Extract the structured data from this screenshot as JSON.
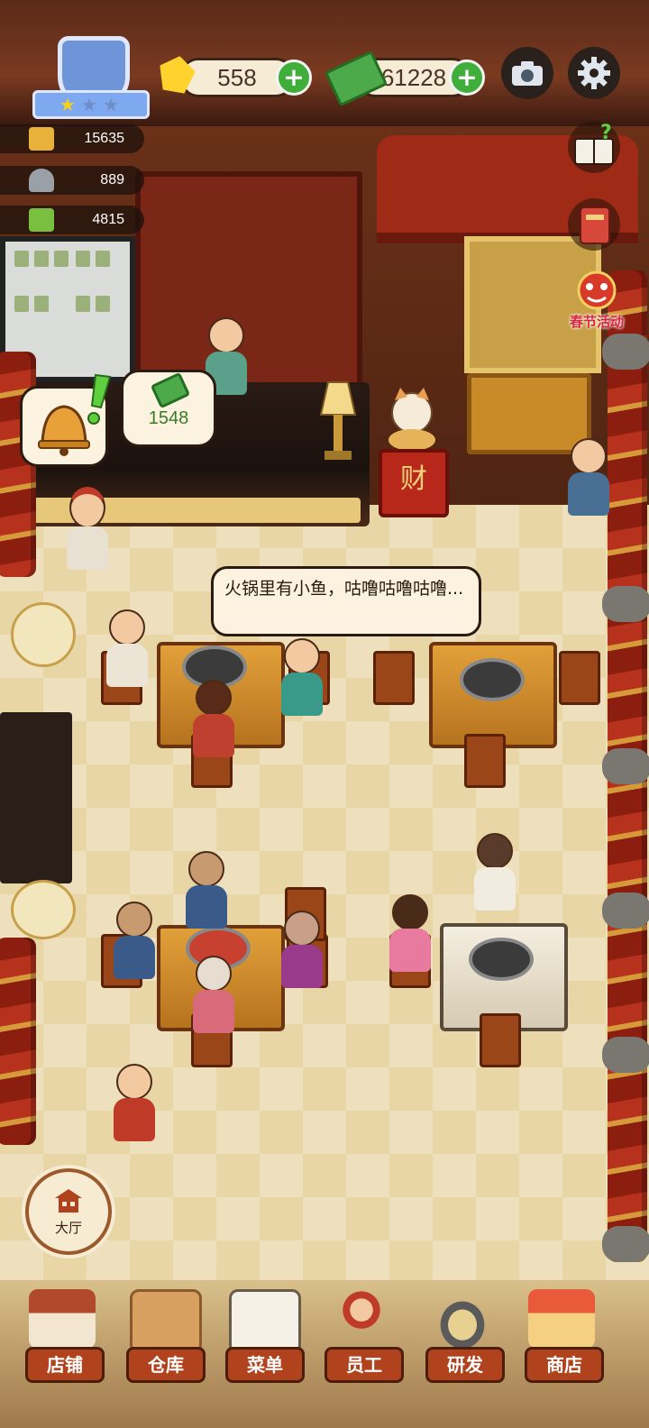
{
  "hud": {
    "gems": "558",
    "cash": "61228",
    "stars_filled": 1,
    "stars_total": 3
  },
  "stats": [
    {
      "icon": "hotpot-icon",
      "value": "15635"
    },
    {
      "icon": "dish-cover-icon",
      "value": "889"
    },
    {
      "icon": "cash-book-icon",
      "value": "4815"
    }
  ],
  "events": {
    "spring_festival_label": "春节活动"
  },
  "bubbles": {
    "tip_amount": "1548",
    "customer_speech": "火锅里有小鱼，咕噜咕噜咕噜..."
  },
  "hall_button": {
    "label": "大厅"
  },
  "bottom_nav": [
    {
      "id": "shop",
      "label": "店铺"
    },
    {
      "id": "warehouse",
      "label": "仓库"
    },
    {
      "id": "menu",
      "label": "菜单"
    },
    {
      "id": "staff",
      "label": "员工"
    },
    {
      "id": "research",
      "label": "研发"
    },
    {
      "id": "store",
      "label": "商店"
    }
  ],
  "decor": {
    "fortune_sign": "财"
  },
  "colors": {
    "accent_green": "#3fae3a",
    "nav_red": "#b0431e",
    "floor": "#e8d6a6"
  }
}
